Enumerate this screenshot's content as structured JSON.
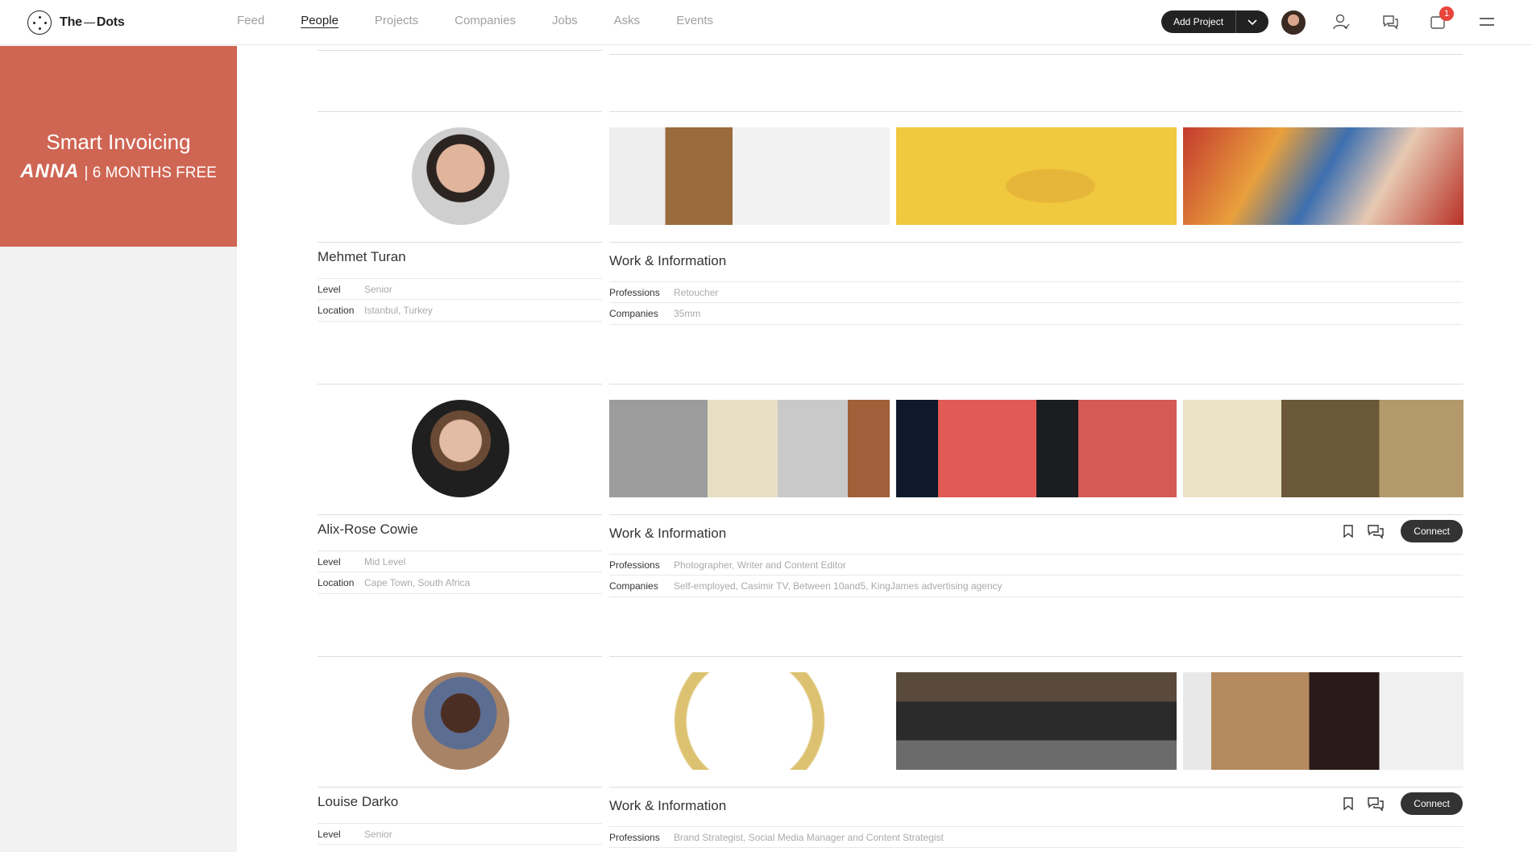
{
  "brand": {
    "name_left": "The",
    "name_right": "Dots"
  },
  "nav": [
    "Feed",
    "People",
    "Projects",
    "Companies",
    "Jobs",
    "Asks",
    "Events"
  ],
  "header": {
    "add_project_label": "Add Project",
    "notification_count": "1"
  },
  "ad": {
    "title": "Smart Invoicing",
    "brand": "ANNA",
    "offer": "| 6 MONTHS FREE",
    "color": "#cf6553"
  },
  "profiles": [
    {
      "name": "Mehmet Turan",
      "level_label": "Level",
      "level": "Senior",
      "location_label": "Location",
      "location": "Istanbul, Turkey",
      "work_title": "Work & Information",
      "professions_label": "Professions",
      "professions": "Retoucher",
      "companies_label": "Companies",
      "companies": "35mm"
    },
    {
      "name": "Alix-Rose Cowie",
      "level_label": "Level",
      "level": "Mid Level",
      "location_label": "Location",
      "location": "Cape Town, South Africa",
      "work_title": "Work & Information",
      "professions_label": "Professions",
      "professions": "Photographer, Writer and Content Editor",
      "companies_label": "Companies",
      "companies": "Self-employed, Casimir TV, Between 10and5, KingJames advertising agency",
      "connect_label": "Connect"
    },
    {
      "name": "Louise Darko",
      "level_label": "Level",
      "level": "Senior",
      "work_title": "Work & Information",
      "professions_label": "Professions",
      "professions": "Brand Strategist, Social Media Manager and Content Strategist",
      "connect_label": "Connect"
    }
  ]
}
